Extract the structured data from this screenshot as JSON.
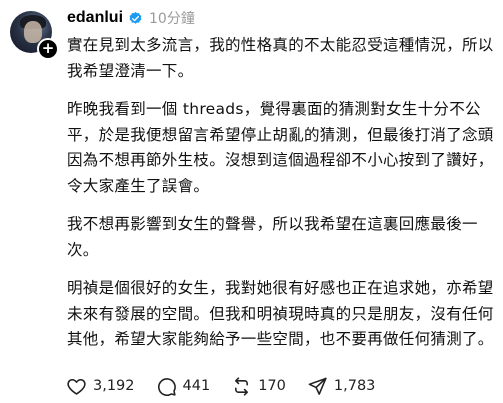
{
  "post": {
    "username": "edanlui",
    "timestamp": "10分鐘",
    "paragraphs": [
      "實在見到太多流言，我的性格真的不太能忍受這種情況，所以我希望澄清一下。",
      "昨晚我看到一個 threads，覺得裏面的猜測對女生十分不公平，於是我便想留言希望停止胡亂的猜測，但最後打消了念頭因為不想再節外生枝。沒想到這個過程卻不小心按到了讚好，令大家產生了誤會。",
      "我不想再影響到女生的聲譽，所以我希望在這裏回應最後一次。",
      "明禎是個很好的女生，我對她很有好感也正在追求她，亦希望未來有發展的空間。但我和明禎現時真的只是朋友，沒有任何其他，希望大家能夠給予一些空間，也不要再做任何猜測了。"
    ],
    "likes": "3,192",
    "comments": "441",
    "reposts": "170",
    "shares": "1,783"
  },
  "icons": {
    "avatar": "profile-photo",
    "follow": "plus-icon",
    "verified": "verified-badge-icon",
    "like": "heart-icon",
    "comment": "comment-bubble-icon",
    "repost": "repost-icon",
    "share": "send-icon"
  },
  "colors": {
    "verified": "#1d9bf0",
    "timestamp": "#9a9a9a",
    "text": "#111111"
  }
}
